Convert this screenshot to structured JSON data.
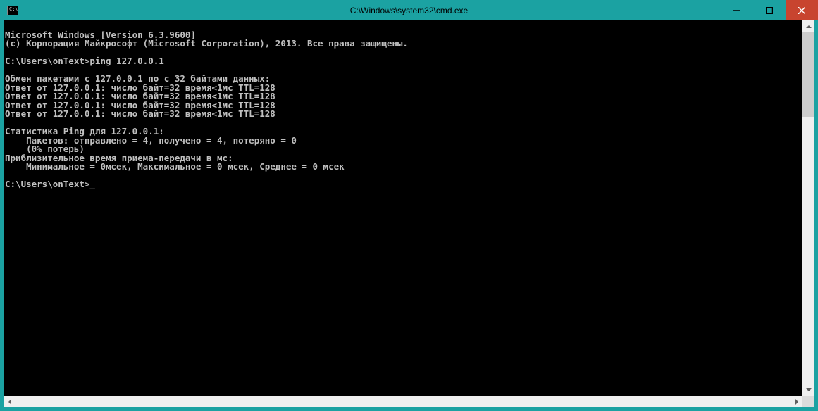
{
  "window": {
    "title": "C:\\Windows\\system32\\cmd.exe",
    "icon_text": "C:\\"
  },
  "console": {
    "lines": [
      "Microsoft Windows [Version 6.3.9600]",
      "(c) Корпорация Майкрософт (Microsoft Corporation), 2013. Все права защищены.",
      "",
      "C:\\Users\\onText>ping 127.0.0.1",
      "",
      "Обмен пакетами с 127.0.0.1 по с 32 байтами данных:",
      "Ответ от 127.0.0.1: число байт=32 время<1мс TTL=128",
      "Ответ от 127.0.0.1: число байт=32 время<1мс TTL=128",
      "Ответ от 127.0.0.1: число байт=32 время<1мс TTL=128",
      "Ответ от 127.0.0.1: число байт=32 время<1мс TTL=128",
      "",
      "Статистика Ping для 127.0.0.1:",
      "    Пакетов: отправлено = 4, получено = 4, потеряно = 0",
      "    (0% потерь)",
      "Приблизительное время приема-передачи в мс:",
      "    Минимальное = 0мсек, Максимальное = 0 мсек, Среднее = 0 мсек",
      "",
      "C:\\Users\\onText>_"
    ]
  }
}
